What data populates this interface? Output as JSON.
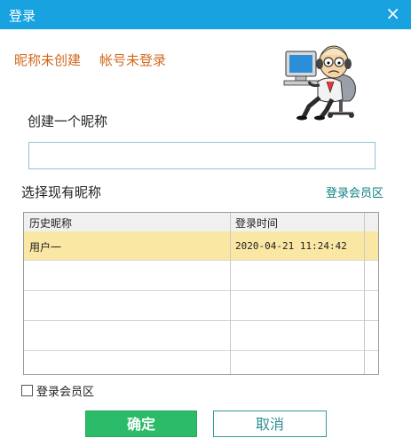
{
  "window": {
    "title": "登录",
    "close_glyph": "×"
  },
  "status": {
    "nickname": "昵称未创建",
    "account": "帐号未登录"
  },
  "create": {
    "label": "创建一个昵称",
    "input_value": ""
  },
  "existing": {
    "label": "选择现有昵称",
    "member_link": "登录会员区"
  },
  "table": {
    "headers": [
      "历史昵称",
      "登录时间"
    ],
    "rows": [
      {
        "name": "用户一",
        "time": "2020-04-21 11:24:42",
        "selected": true
      }
    ]
  },
  "checkbox": {
    "label": "登录会员区",
    "checked": false
  },
  "buttons": {
    "ok": "确定",
    "cancel": "取消"
  },
  "icons": {
    "close": "close-icon",
    "mascot": "mascot-illustration"
  },
  "colors": {
    "title_bar": "#18a2e0",
    "status_text": "#d2691e",
    "accent_teal": "#0f7f7f",
    "selected_row": "#fbe7a4",
    "ok_button": "#2cbb69"
  }
}
